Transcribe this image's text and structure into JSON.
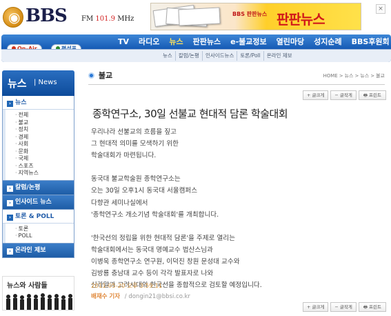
{
  "header": {
    "logo_text": "BBS",
    "frequency_prefix": "FM",
    "frequency_value": "101.9",
    "frequency_unit": "MHz",
    "banner_small": "BBS 판판뉴스",
    "banner_big": "판판뉴스"
  },
  "nav": {
    "onair": "On-Air",
    "schedule": "편성표",
    "main_items": [
      {
        "label": "TV"
      },
      {
        "label": "라디오"
      },
      {
        "label": "뉴스"
      },
      {
        "label": "판판뉴스"
      },
      {
        "label": "e-불교정보"
      },
      {
        "label": "열린마당"
      },
      {
        "label": "성지순례"
      },
      {
        "label": "BBS후원회"
      }
    ],
    "active_index": 2,
    "sub_items": [
      {
        "label": "뉴스"
      },
      {
        "label": "칼럼/논평"
      },
      {
        "label": "인사이드뉴스"
      },
      {
        "label": "토론/Poll"
      },
      {
        "label": "온라인 제보"
      }
    ]
  },
  "sidebar": {
    "head_kor": "뉴스",
    "head_eng": "| News",
    "sections": [
      {
        "title": "뉴스",
        "items": [
          "전체",
          "불교",
          "정치",
          "경제",
          "사회",
          "문화",
          "국제",
          "스포츠",
          "지역뉴스"
        ]
      },
      {
        "title": "칼럼/논평",
        "items": []
      },
      {
        "title": "인사이드 뉴스",
        "items": []
      },
      {
        "title": "토론 & POLL",
        "items": [
          "토론",
          "POLL"
        ]
      },
      {
        "title": "온라인 제보",
        "items": []
      }
    ],
    "banner_text": "뉴스와 사람들"
  },
  "content": {
    "section_title": "불교",
    "breadcrumb": [
      "HOME",
      "뉴스",
      "뉴스",
      "불교"
    ],
    "tools": {
      "font_up": "+ 글크게",
      "font_down": "− 글작게",
      "print": "프린트"
    },
    "article": {
      "title": "종학연구소, 30일 선불교 현대적 담론 학술대회",
      "paragraphs": [
        [
          "우리나라 선불교의 흐름을 짚고",
          "그 현대적 의미를 모색하기 위한",
          "학술대회가 마련됩니다."
        ],
        [
          "동국대 불교학술원 종학연구소는",
          "오는 30일 오후1시 동국대 서울캠퍼스",
          "다향관 세미나실에서",
          "'종학연구소 개소기념 학술대회'를 개최합니다."
        ],
        [
          "'한국선의 정립을 위한 현대적 담론'을 주제로 열리는",
          "학술대회에서는 동국대 명예교수 법산스님과",
          "이병욱 종학연구소 연구원, 이덕진 창원 문성대 교수와",
          "김방룡 충남대 교수 등이 각각 발표자로 나와",
          "신라말과 고려시대의 한국선을 종합적으로 검토할 예정입니다."
        ]
      ],
      "date": "2011-05-20 오후 3:59:11",
      "author": "배재수 기자",
      "email": "/ dongin21@bbsi.co.kr"
    }
  },
  "colors": {
    "nav_blue": "#1458b3",
    "active_menu": "#ffe25a",
    "date_orange": "#e0a04a"
  }
}
